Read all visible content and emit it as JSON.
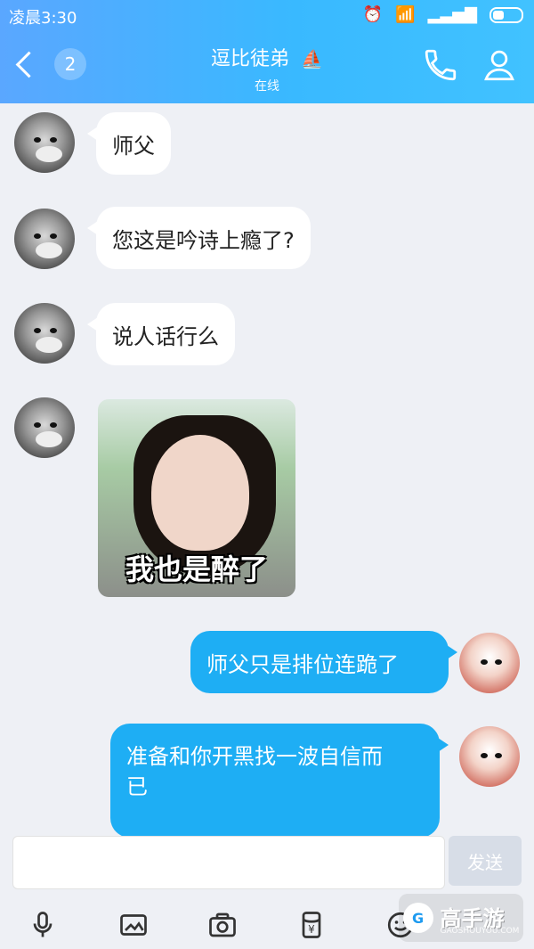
{
  "status": {
    "time": "凌晨3:30"
  },
  "header": {
    "back_count": "2",
    "contact_name": "逗比徒弟",
    "contact_badge": "⛵",
    "contact_status": "在线"
  },
  "messages": [
    {
      "side": "left",
      "text": "师父"
    },
    {
      "side": "left",
      "text": "您这是吟诗上瘾了?"
    },
    {
      "side": "left",
      "text": "说人话行么"
    },
    {
      "side": "left",
      "type": "sticker",
      "caption": "我也是醉了"
    },
    {
      "side": "right",
      "text": "师父只是排位连跪了"
    },
    {
      "side": "right",
      "text": "准备和你开黑找一波自信而\n已"
    }
  ],
  "composer": {
    "placeholder": "",
    "send_label": "发送"
  },
  "toolbar": {
    "icons": [
      "microphone-icon",
      "image-icon",
      "camera-icon",
      "red-packet-icon",
      "emoji-icon"
    ]
  },
  "watermark": {
    "brand": "高手游",
    "domain": "GAOSHOUYOU.COM"
  },
  "colors": {
    "header_start": "#5aa7ff",
    "header_end": "#41c2ff",
    "bubble_self": "#1eaef4",
    "bubble_other": "#ffffff",
    "background": "#eef0f5"
  }
}
